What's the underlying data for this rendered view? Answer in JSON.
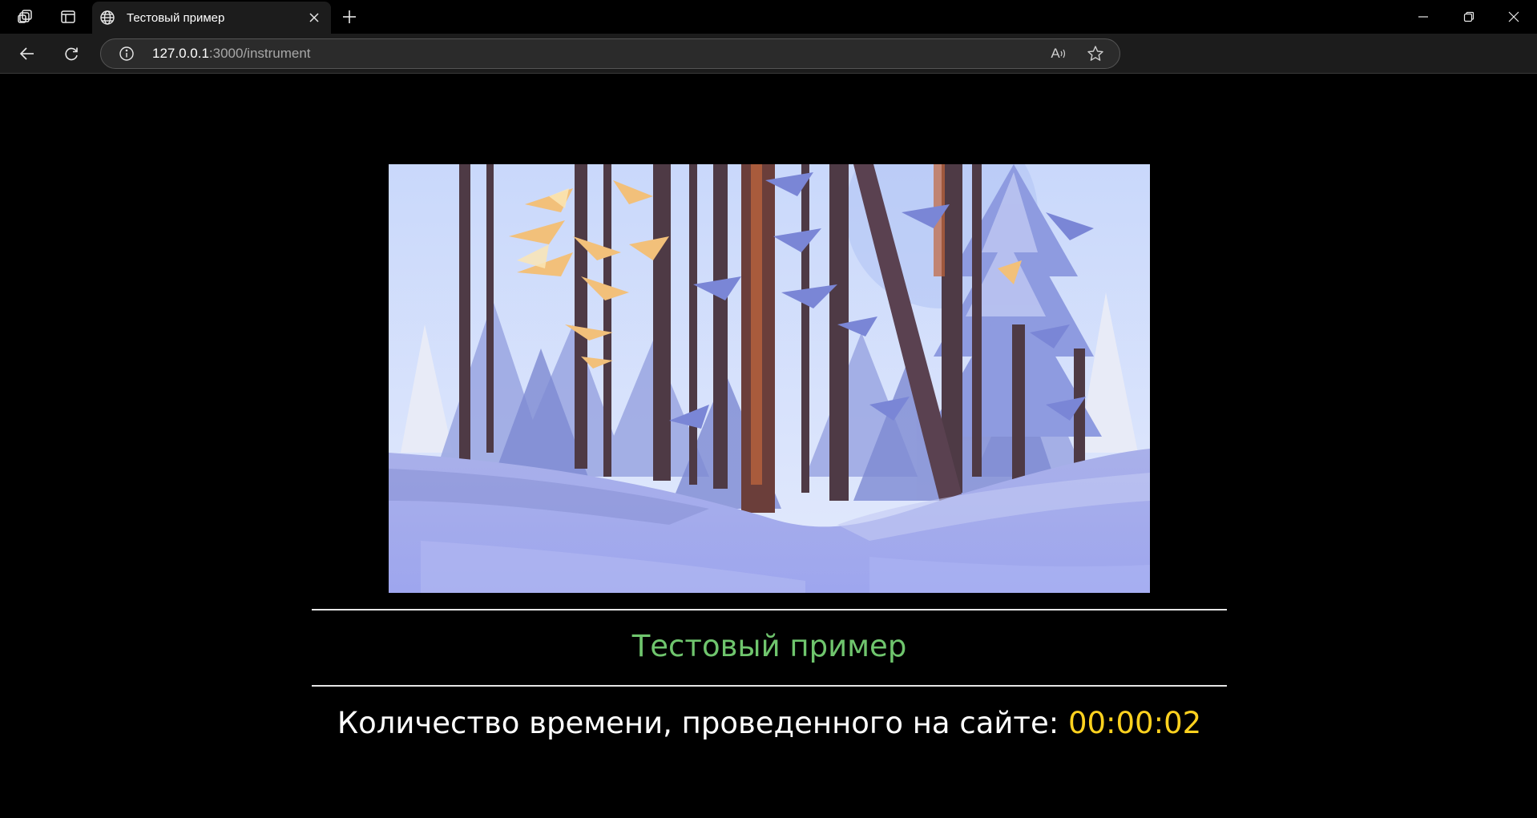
{
  "browser": {
    "tab": {
      "title": "Тестовый пример",
      "favicon": "globe-icon"
    },
    "address": {
      "host": "127.0.0.1",
      "rest": ":3000/instrument"
    },
    "read_aloud_label": "A",
    "icons": {
      "workspaces": "workspaces-icon",
      "tab_actions": "tab-actions-icon",
      "new_tab": "plus-icon",
      "minimize": "minimize-icon",
      "restore": "restore-icon",
      "close": "close-icon",
      "back": "back-arrow-icon",
      "refresh": "refresh-icon",
      "info": "info-icon",
      "favorite": "star-icon"
    }
  },
  "page": {
    "title": "Тестовый пример",
    "timer_label": "Количество времени, проведенного на сайте: ",
    "timer_value": "00:00:02"
  },
  "colors": {
    "background": "#000000",
    "title": "#6fc56d",
    "timer_value": "#ffd21f",
    "divider": "#e6e6e6"
  }
}
